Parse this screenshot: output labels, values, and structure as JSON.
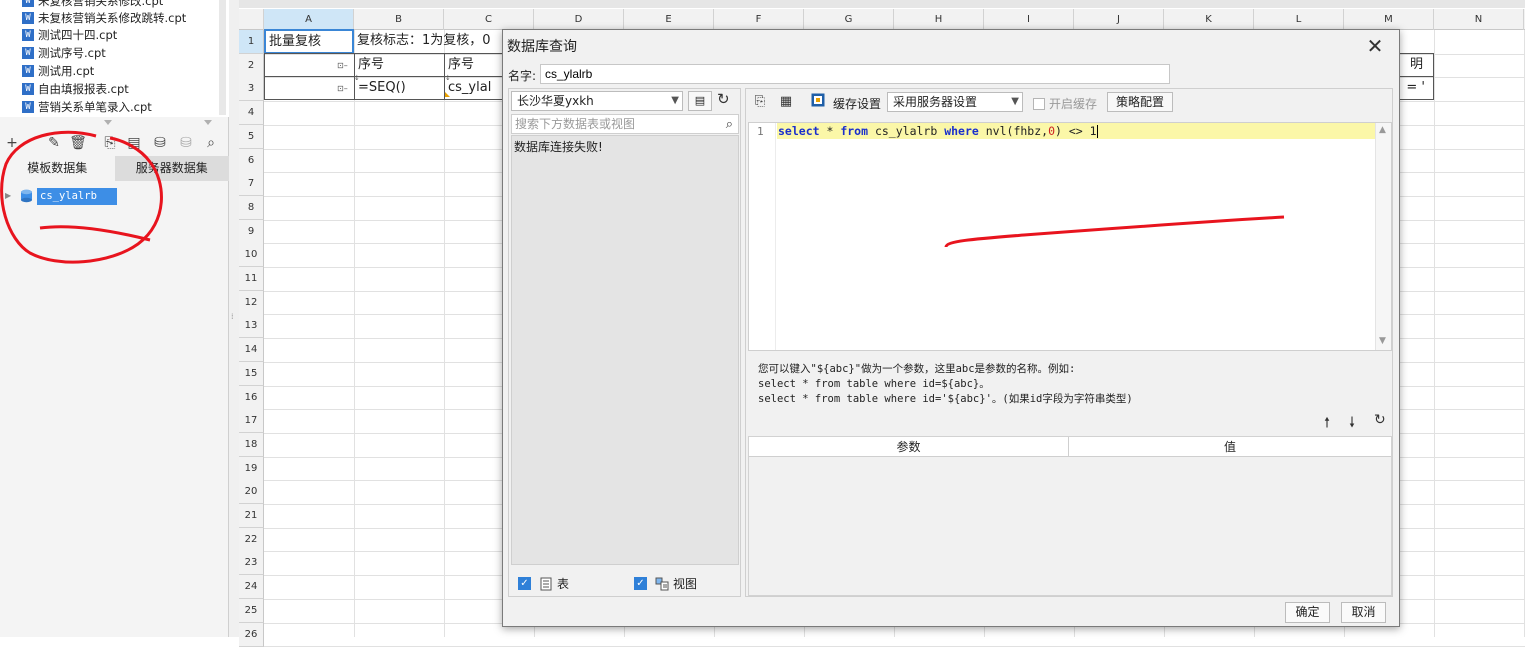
{
  "file_list": [
    "未复核营销关系修改.cpt",
    "未复核营销关系修改跳转.cpt",
    "测试四十四.cpt",
    "测试序号.cpt",
    "测试用.cpt",
    "自由填报报表.cpt",
    "营销关系单笔录入.cpt"
  ],
  "file_icon_glyph": "W",
  "dataset_tabs": {
    "template": "模板数据集",
    "server": "服务器数据集"
  },
  "dataset_node": "cs_ylalrb",
  "toolbar_icons": [
    "plus-icon",
    "edit-icon",
    "delete-icon",
    "preview-icon",
    "db-query-icon",
    "db-icon",
    "db-disabled-icon",
    "search-icon"
  ],
  "columns": [
    "A",
    "B",
    "C",
    "D",
    "E",
    "F",
    "G",
    "H",
    "I",
    "J",
    "K",
    "L",
    "M",
    "N"
  ],
  "rows": [
    "1",
    "2",
    "3",
    "4",
    "5",
    "6",
    "7",
    "8",
    "9",
    "10",
    "11",
    "12",
    "13",
    "14",
    "15",
    "16",
    "17",
    "18",
    "19",
    "20",
    "21",
    "22",
    "23",
    "24",
    "25",
    "26"
  ],
  "cells": {
    "a1": "批量复核",
    "b1": "复核标志：1为复核，0",
    "b2": "序号",
    "c2": "序号",
    "b3": "=SEQ()",
    "c3": "cs_ylal",
    "m2": "明",
    "m3": "= '"
  },
  "dialog": {
    "title": "数据库查询",
    "name_label": "名字:",
    "name_value": "cs_ylalrb",
    "db_select": "长沙华夏yxkh",
    "search_placeholder": "搜索下方数据表或视图",
    "conn_fail": "数据库连接失败!",
    "chk_table": "表",
    "chk_view": "视图",
    "cache_label": "缓存设置",
    "cache_select": "采用服务器设置",
    "enable_cache": "开启缓存",
    "strategy_btn": "策略配置",
    "line_number": "1",
    "sql": {
      "kw1": "select",
      "t1": " * ",
      "kw2": "from",
      "t2": " cs_ylalrb ",
      "kw3": "where",
      "t3": " nvl(fhbz,",
      "n1": "0",
      "t4": ") <> ",
      "n2": "1"
    },
    "hint1": "您可以键入\"${abc}\"做为一个参数，这里abc是参数的名称。例如:",
    "hint2": "select * from table where id=${abc}。",
    "hint3": "select * from table where id='${abc}'。(如果id字段为字符串类型)",
    "param_col_name": "参数",
    "param_col_value": "值",
    "ok": "确定",
    "cancel": "取消"
  },
  "colors": {
    "accent": "#3d8ee6",
    "annotation": "#e8141e",
    "sql_highlight": "#fbf7a8"
  }
}
